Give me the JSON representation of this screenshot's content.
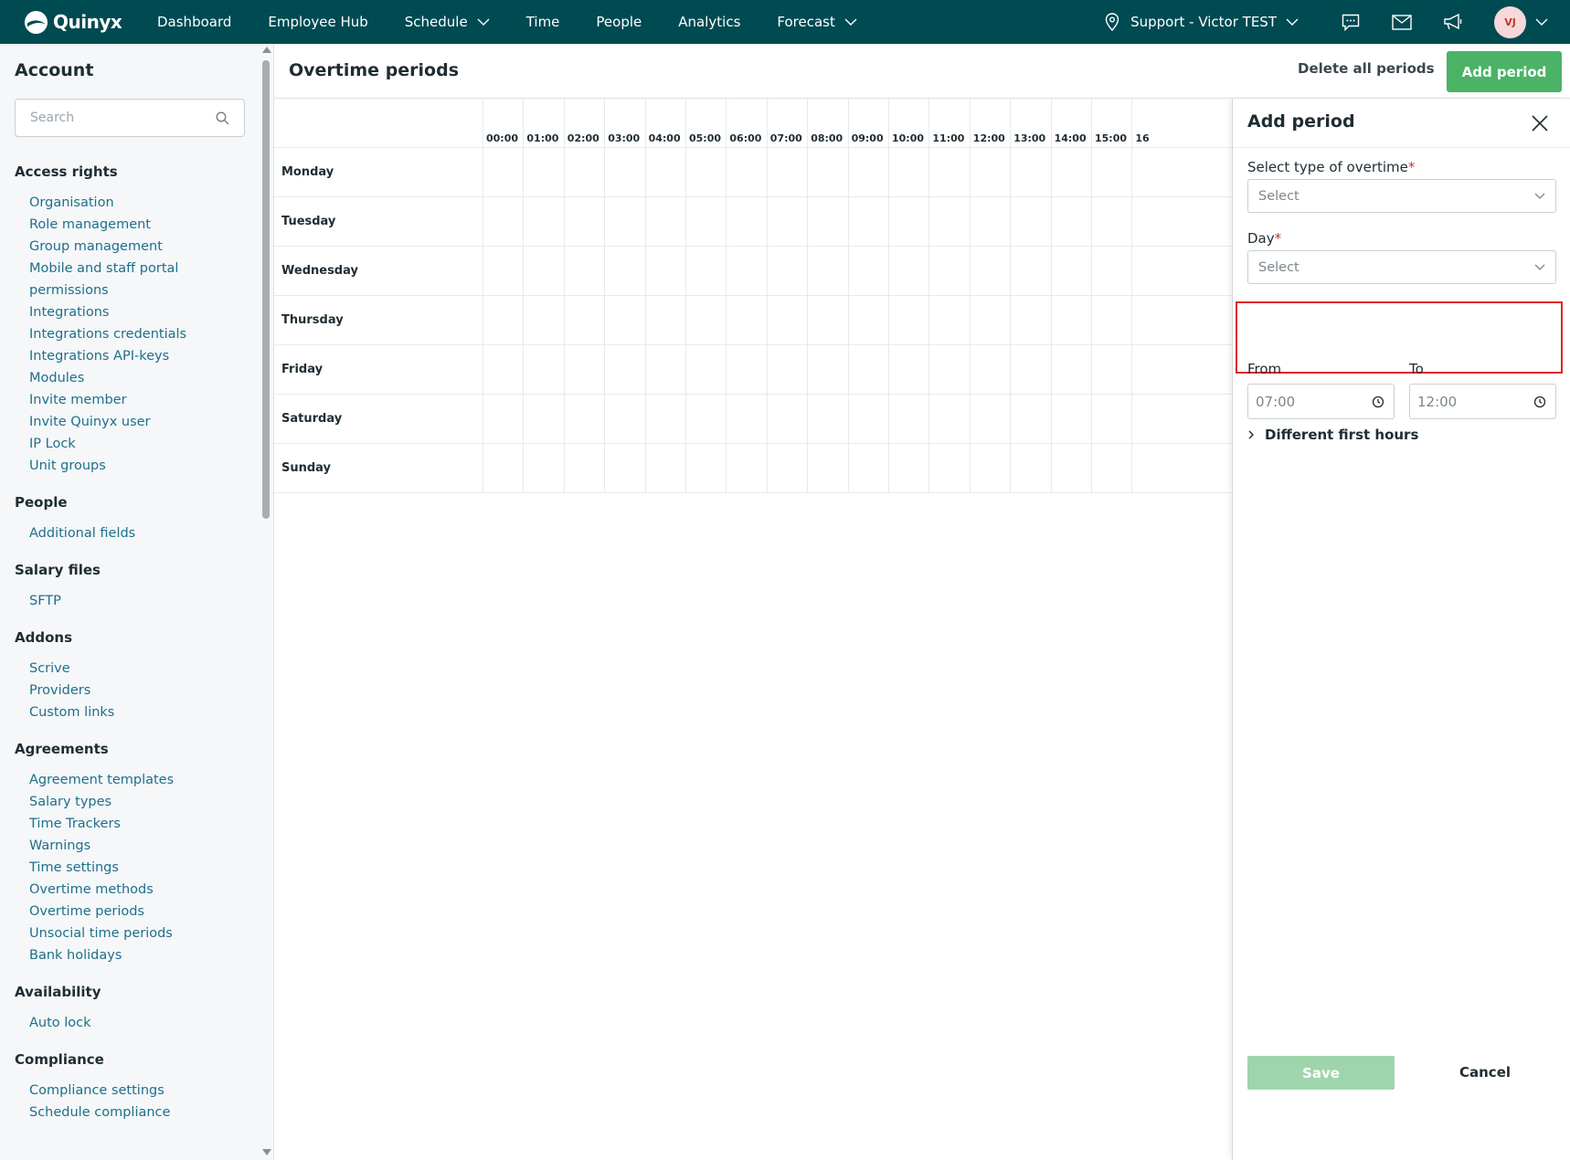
{
  "topbar": {
    "logo_text": "Quinyx",
    "nav": [
      {
        "label": "Dashboard",
        "dropdown": false
      },
      {
        "label": "Employee Hub",
        "dropdown": false
      },
      {
        "label": "Schedule",
        "dropdown": true
      },
      {
        "label": "Time",
        "dropdown": false
      },
      {
        "label": "People",
        "dropdown": false
      },
      {
        "label": "Analytics",
        "dropdown": false
      },
      {
        "label": "Forecast",
        "dropdown": true
      }
    ],
    "unit_selector": "Support - Victor TEST",
    "icons": [
      "chat-icon",
      "mail-icon",
      "megaphone-icon"
    ],
    "avatar_initials": "VJ",
    "colors": {
      "bar": "#004a52"
    }
  },
  "sidebar": {
    "title": "Account",
    "search_placeholder": "Search",
    "sections": [
      {
        "heading": "Access rights",
        "items": [
          "Organisation",
          "Role management",
          "Group management",
          "Mobile and staff portal",
          "permissions",
          "Integrations",
          "Integrations credentials",
          "Integrations API-keys",
          "Modules",
          "Invite member",
          "Invite Quinyx user",
          "IP Lock",
          "Unit groups"
        ]
      },
      {
        "heading": "People",
        "items": [
          "Additional fields"
        ]
      },
      {
        "heading": "Salary files",
        "items": [
          "SFTP"
        ]
      },
      {
        "heading": "Addons",
        "items": [
          "Scrive",
          "Providers",
          "Custom links"
        ]
      },
      {
        "heading": "Agreements",
        "items": [
          "Agreement templates",
          "Salary types",
          "Time Trackers",
          "Warnings",
          "Time settings",
          "Overtime methods",
          "Overtime periods",
          "Unsocial time periods",
          "Bank holidays"
        ]
      },
      {
        "heading": "Availability",
        "items": [
          "Auto lock"
        ]
      },
      {
        "heading": "Compliance",
        "items": [
          "Compliance settings",
          "Schedule compliance"
        ]
      }
    ]
  },
  "main": {
    "title": "Overtime periods",
    "delete_all_label": "Delete all periods",
    "add_period_label": "Add period",
    "accent_color": "#4bb366",
    "hours": [
      "00:00",
      "01:00",
      "02:00",
      "03:00",
      "04:00",
      "05:00",
      "06:00",
      "07:00",
      "08:00",
      "09:00",
      "10:00",
      "11:00",
      "12:00",
      "13:00",
      "14:00",
      "15:00",
      "16"
    ],
    "days": [
      "Monday",
      "Tuesday",
      "Wednesday",
      "Thursday",
      "Friday",
      "Saturday",
      "Sunday"
    ]
  },
  "panel": {
    "title": "Add period",
    "overtime_type_label": "Select type of overtime",
    "overtime_type_value": "Select",
    "day_label": "Day",
    "day_value": "Select",
    "required_mark": "*",
    "from_label": "From",
    "from_value": "07:00",
    "to_label": "To",
    "to_value": "12:00",
    "different_first_hours_label": "Different first hours",
    "save_label": "Save",
    "cancel_label": "Cancel",
    "highlight_color": "#e0242a"
  }
}
